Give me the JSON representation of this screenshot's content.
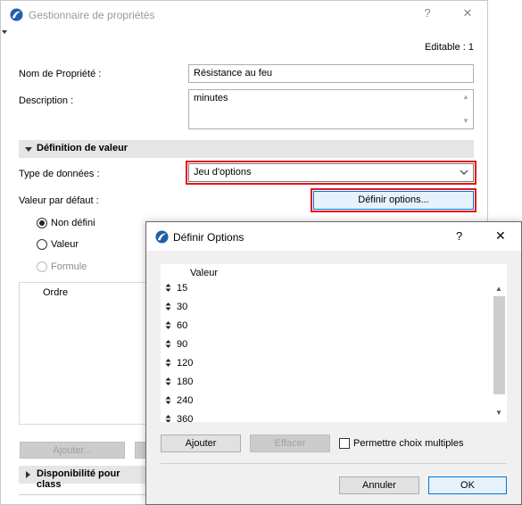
{
  "main_window": {
    "title": "Gestionnaire de propriétés",
    "help_glyph": "?",
    "close_glyph": "✕",
    "editable_label": "Editable : 1",
    "name_label": "Nom de Propriété :",
    "name_value": "Résistance au feu",
    "description_label": "Description :",
    "description_value": "minutes",
    "value_section_title": "Définition de valeur",
    "data_type_label": "Type de données :",
    "data_type_value": "Jeu d'options",
    "default_value_label": "Valeur par défaut :",
    "define_options_button": "Définir options...",
    "radio_undefined": "Non défini",
    "radio_value": "Valeur",
    "radio_formula": "Formule",
    "order_label": "Ordre",
    "add_button": "Ajouter...",
    "availability_section_title": "Disponibilité pour class"
  },
  "dialog": {
    "title": "Définir Options",
    "help_glyph": "?",
    "close_glyph": "✕",
    "column_header": "Valeur",
    "options": [
      "15",
      "30",
      "60",
      "90",
      "120",
      "180",
      "240",
      "360"
    ],
    "add_button": "Ajouter",
    "delete_button": "Effacer",
    "multiple_choice_label": "Permettre choix multiples",
    "multiple_choice_checked": false,
    "cancel_button": "Annuler",
    "ok_button": "OK"
  },
  "colors": {
    "highlight_frame": "#e0161e",
    "primary_button_border": "#0078d7",
    "app_icon": "#1e5fa8"
  }
}
